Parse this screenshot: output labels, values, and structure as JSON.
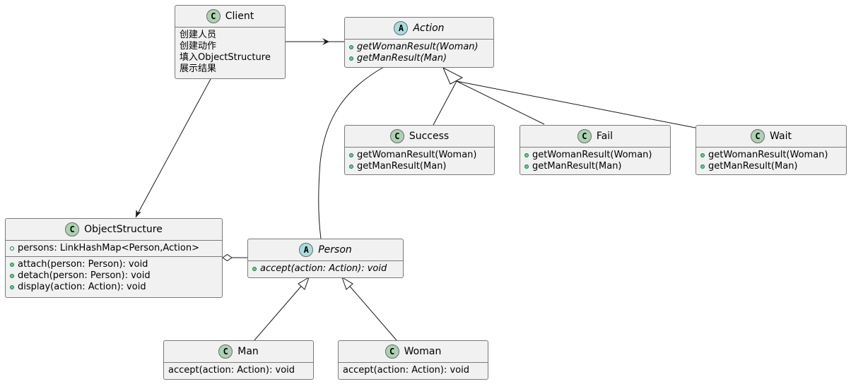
{
  "diagram": {
    "type": "uml-class-diagram",
    "colors": {
      "class_badge": "#ADD1B2",
      "abstract_badge": "#A9DCDF",
      "box_fill": "#F1F1F1",
      "public_marker": "#84BE84"
    },
    "classes": {
      "client": {
        "name": "Client",
        "badge": "C",
        "notes": [
          "创建人员",
          "创建动作",
          "填入ObjectStructure",
          "展示结果"
        ]
      },
      "action": {
        "name": "Action",
        "badge": "A",
        "abstract": true,
        "methods": [
          "getWomanResult(Woman)",
          "getManResult(Man)"
        ]
      },
      "success": {
        "name": "Success",
        "badge": "C",
        "methods": [
          "getWomanResult(Woman)",
          "getManResult(Man)"
        ]
      },
      "fail": {
        "name": "Fail",
        "badge": "C",
        "methods": [
          "getWomanResult(Woman)",
          "getManResult(Man)"
        ]
      },
      "wait": {
        "name": "Wait",
        "badge": "C",
        "methods": [
          "getWomanResult(Woman)",
          "getManResult(Man)"
        ]
      },
      "object_structure": {
        "name": "ObjectStructure",
        "badge": "C",
        "fields": [
          "persons: LinkHashMap<Person,Action>"
        ],
        "methods": [
          "attach(person: Person): void",
          "detach(person: Person): void",
          "display(action: Action): void"
        ]
      },
      "person": {
        "name": "Person",
        "badge": "A",
        "abstract": true,
        "methods": [
          "accept(action: Action): void"
        ]
      },
      "man": {
        "name": "Man",
        "badge": "C",
        "members": [
          "accept(action: Action): void"
        ]
      },
      "woman": {
        "name": "Woman",
        "badge": "C",
        "members": [
          "accept(action: Action): void"
        ]
      }
    },
    "relations": [
      {
        "from": "Client",
        "to": "Action",
        "kind": "association-arrow"
      },
      {
        "from": "Client",
        "to": "ObjectStructure",
        "kind": "association-arrow"
      },
      {
        "from": "Success",
        "to": "Action",
        "kind": "inheritance"
      },
      {
        "from": "Fail",
        "to": "Action",
        "kind": "inheritance"
      },
      {
        "from": "Wait",
        "to": "Action",
        "kind": "inheritance"
      },
      {
        "from": "Action",
        "to": "Person",
        "kind": "association"
      },
      {
        "from": "ObjectStructure",
        "to": "Person",
        "kind": "aggregation"
      },
      {
        "from": "Man",
        "to": "Person",
        "kind": "inheritance"
      },
      {
        "from": "Woman",
        "to": "Person",
        "kind": "inheritance"
      }
    ]
  }
}
